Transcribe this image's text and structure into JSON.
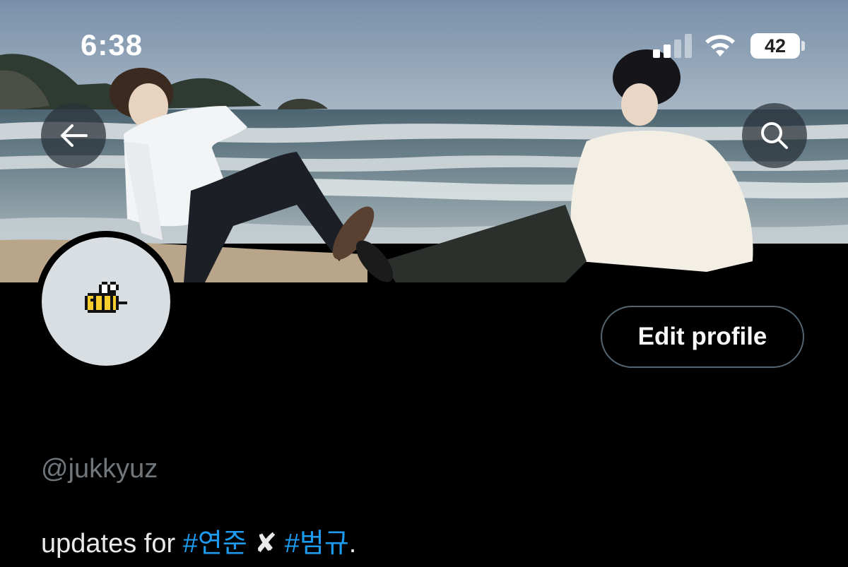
{
  "status_bar": {
    "time": "6:38",
    "battery_level": "42",
    "signal_bars_active": 2,
    "signal_bars_total": 4
  },
  "banner": {
    "description_icons": [
      "back-arrow-icon",
      "search-icon"
    ]
  },
  "avatar": {
    "icon": "bee-icon"
  },
  "profile": {
    "edit_button_label": "Edit profile",
    "handle": "@jukkyuz",
    "bio": {
      "prefix": "updates for ",
      "hashtag_1": "#연준",
      "separator": " ✘ ",
      "hashtag_2": "#범규",
      "suffix": "."
    }
  },
  "colors": {
    "background": "#000000",
    "hashtag": "#1d9bf0",
    "handle": "#71767b",
    "text": "#e7e9ea",
    "button_border": "#536471"
  }
}
